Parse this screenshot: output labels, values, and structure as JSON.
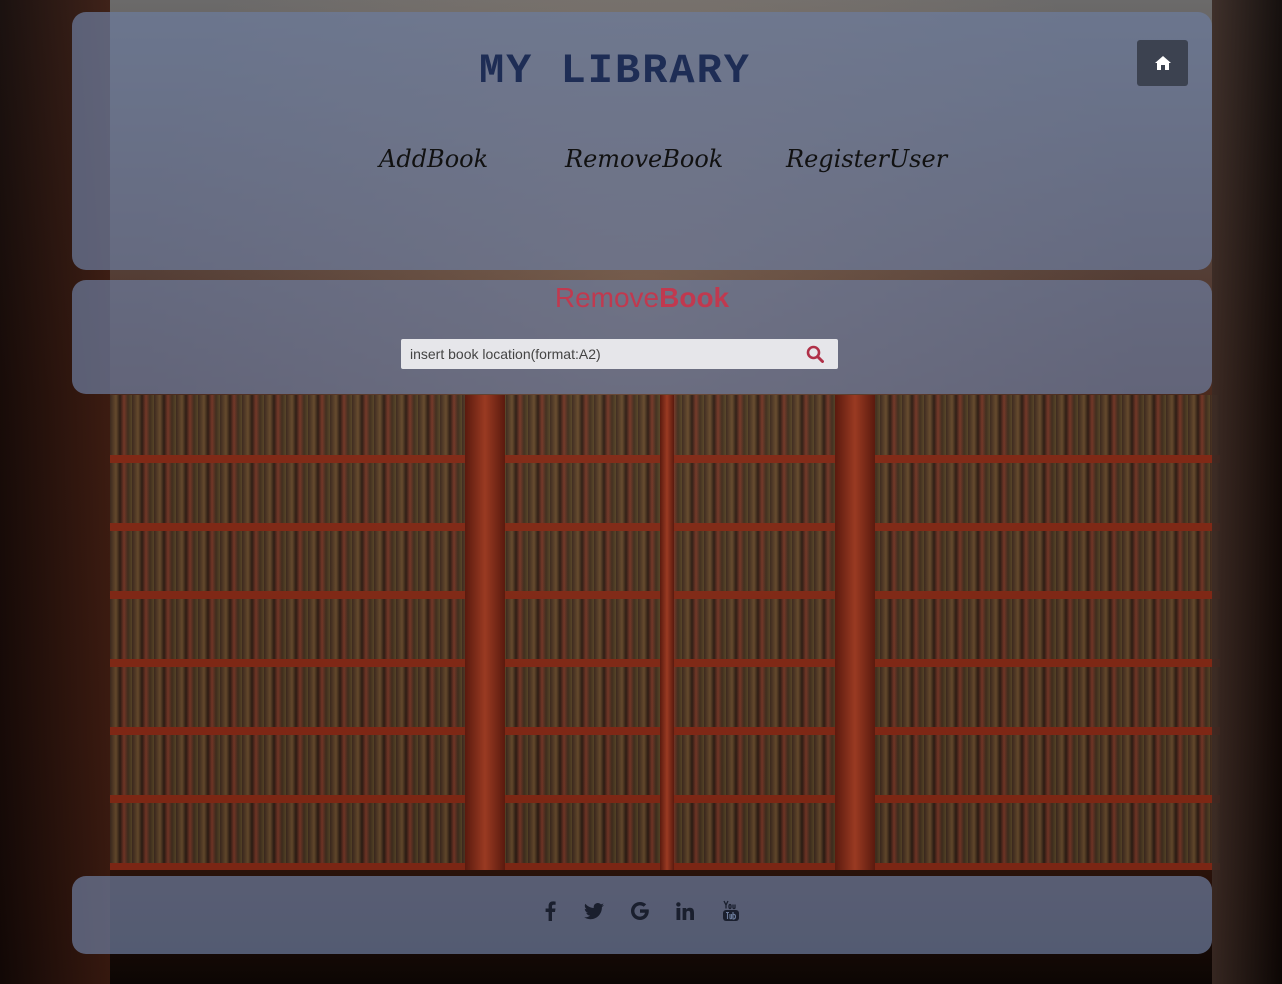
{
  "header": {
    "title": "MY LIBRARY",
    "home_icon": "home-icon"
  },
  "nav": {
    "items": [
      {
        "label": "AddBook"
      },
      {
        "label": "RemoveBook"
      },
      {
        "label": "RegisterUser"
      }
    ]
  },
  "remove_section": {
    "heading_part1": "Remove",
    "heading_part2": "Book",
    "search": {
      "placeholder": "insert book location(format:A2)",
      "value": "",
      "icon": "search-icon"
    }
  },
  "footer": {
    "social_icons": [
      "facebook-icon",
      "twitter-icon",
      "google-icon",
      "linkedin-icon",
      "youtube-icon"
    ]
  },
  "colors": {
    "panel": "#6c7c9c",
    "title": "#1e2d55",
    "accent": "#c0394f",
    "home_button": "#3c4250"
  }
}
